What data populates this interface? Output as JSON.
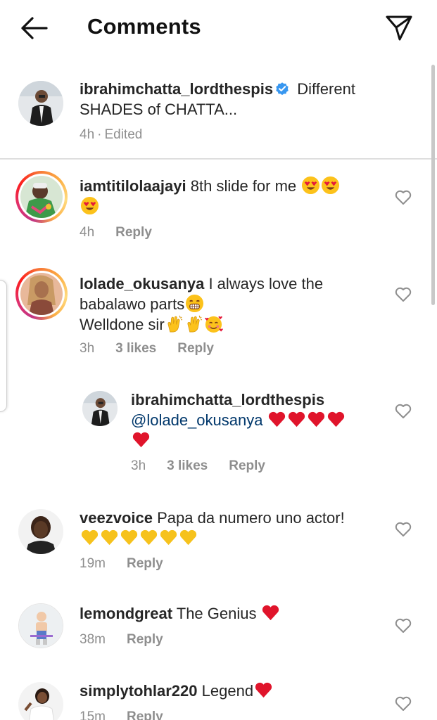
{
  "header": {
    "title": "Comments",
    "back_icon": "arrow-left-icon",
    "share_icon": "paper-plane-icon"
  },
  "caption": {
    "username": "ibrahimchatta_lordthespis",
    "text_line1": "Different",
    "text_line2": "SHADES of CHATTA...",
    "time": "4h",
    "separator": "·",
    "edited": "Edited"
  },
  "comments": [
    {
      "username": "iamtitilolaajayi",
      "text": "8th slide for me",
      "emojis_line1": [
        "heart-eyes-emoji",
        "heart-eyes-emoji"
      ],
      "emojis_line2": [
        "heart-eyes-emoji"
      ],
      "time": "4h",
      "reply": "Reply"
    },
    {
      "username": "lolade_okusanya",
      "text": "I always love the",
      "text_line2": "babalawo parts",
      "text_line3": "Welldone sir",
      "emojis_line2": [
        "grinning-emoji"
      ],
      "emojis_line3": [
        "clapping-hands-emoji",
        "clapping-hands-emoji",
        "smiling-face-with-hearts-emoji"
      ],
      "time": "3h",
      "likes": "3 likes",
      "reply": "Reply"
    },
    {
      "username": "ibrahimchatta_lordthespis",
      "mention": "@lolade_okusanya",
      "emojis_line1": [
        "red-heart-emoji",
        "red-heart-emoji",
        "red-heart-emoji",
        "red-heart-emoji"
      ],
      "emojis_line2": [
        "red-heart-emoji"
      ],
      "time": "3h",
      "likes": "3 likes",
      "reply": "Reply"
    },
    {
      "username": "veezvoice",
      "text": "Papa da numero uno actor!",
      "emojis_line2": [
        "yellow-heart-emoji",
        "yellow-heart-emoji",
        "yellow-heart-emoji",
        "yellow-heart-emoji",
        "yellow-heart-emoji",
        "yellow-heart-emoji"
      ],
      "time": "19m",
      "reply": "Reply"
    },
    {
      "username": "lemondgreat",
      "text": "The Genius",
      "emojis_line1": [
        "red-heart-emoji"
      ],
      "time": "38m",
      "reply": "Reply"
    },
    {
      "username": "simplytohlar220",
      "text": "Legend",
      "emojis_line1": [
        "red-heart-emoji"
      ],
      "time": "15m",
      "reply": "Reply"
    }
  ],
  "colors": {
    "text": "#262626",
    "meta": "#8e8e8e",
    "mention": "#00376b",
    "verified": "#3897f0",
    "heart": "#e0142b",
    "yellow_heart": "#f6c21c"
  }
}
